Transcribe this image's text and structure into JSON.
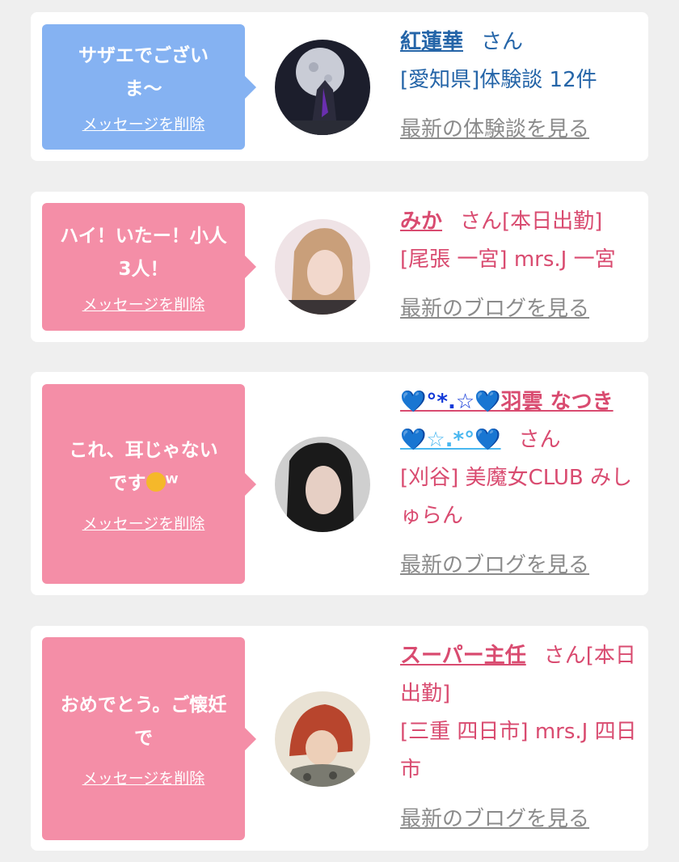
{
  "cards": [
    {
      "message": "サザエでございま〜",
      "delete_label": "メッセージを削除",
      "name": "紅蓮華",
      "suffix": "さん",
      "area": "[愛知県]体験談 12件",
      "more_link": "最新の体験談を見る"
    },
    {
      "message": "ハイ！いたー！小人3人！",
      "delete_label": "メッセージを削除",
      "name": "みか",
      "suffix": "さん[本日出勤]",
      "area": "[尾張 一宮] mrs.J 一宮",
      "more_link": "最新のブログを見る"
    },
    {
      "message_a": "これ、耳じゃない",
      "message_b": "です",
      "message_c": "ᵂ",
      "delete_label": "メッセージを削除",
      "name_a": "💙°*.☆💙",
      "name_b": "羽雲 なつき",
      "name_c": "💙☆.*°💙",
      "suffix": "さん",
      "area": "[刈谷] 美魔女CLUB みしゅらん",
      "more_link": "最新のブログを見る"
    },
    {
      "message": "おめでとう。ご懐妊で",
      "delete_label": "メッセージを削除",
      "name": "スーパー主任",
      "suffix": "さん[本日出勤]",
      "area": "[三重 四日市] mrs.J 四日市",
      "more_link": "最新のブログを見る"
    }
  ],
  "colors": {
    "blue_bubble": "#85b2f2",
    "pink_bubble": "#f48ea7",
    "blue_text": "#2565a8",
    "pink_text": "#d94b70",
    "link_gray": "#8b8b8b"
  },
  "icons": [
    "avatar-moon-night",
    "avatar-woman-blonde",
    "avatar-woman-dark-hair",
    "avatar-man-red-hair",
    "laughing-emoji-icon"
  ]
}
